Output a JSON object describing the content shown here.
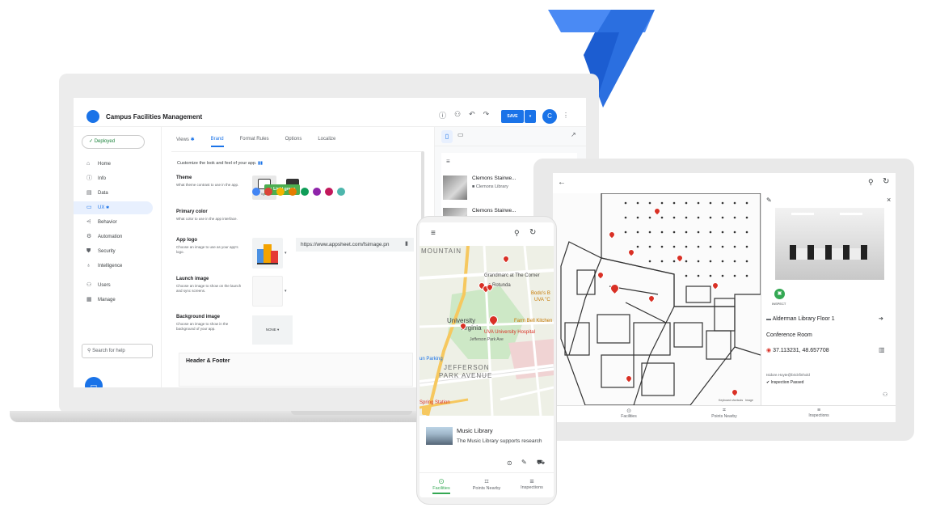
{
  "colors": {
    "brand_blue": "#1a73e8",
    "brand_dark": "#1967d2",
    "deployed_green": "#188038",
    "pin_red": "#d93025",
    "nav_active_green": "#34a853"
  },
  "laptop": {
    "app_title": "Campus Facilities Management",
    "toolbar": {
      "save_label": "SAVE",
      "avatar_initial": "C",
      "icons": [
        "help-icon",
        "add-user-icon",
        "undo-icon",
        "redo-icon"
      ]
    },
    "sidebar": {
      "deployed_label": "Deployed",
      "items": [
        {
          "label": "Home",
          "icon": "home-icon"
        },
        {
          "label": "Info",
          "icon": "info-icon"
        },
        {
          "label": "Data",
          "icon": "data-icon"
        },
        {
          "label": "UX",
          "icon": "ux-icon",
          "active": true
        },
        {
          "label": "Behavior",
          "icon": "behavior-icon"
        },
        {
          "label": "Automation",
          "icon": "automation-icon"
        },
        {
          "label": "Security",
          "icon": "security-icon"
        },
        {
          "label": "Intelligence",
          "icon": "intelligence-icon"
        },
        {
          "label": "Users",
          "icon": "users-icon"
        },
        {
          "label": "Manage",
          "icon": "manage-icon"
        }
      ],
      "search_placeholder": "Search for help"
    },
    "tabs": [
      {
        "label": "Views"
      },
      {
        "label": "Brand",
        "active": true
      },
      {
        "label": "Format Rules"
      },
      {
        "label": "Options"
      },
      {
        "label": "Localize"
      }
    ],
    "brand": {
      "intro": "Customize the look and feel of your app.",
      "theme": {
        "label": "Theme",
        "desc": "What theme contrast to use in the app.",
        "options": [
          "light",
          "dark"
        ]
      },
      "primary_color": {
        "label": "Primary color",
        "desc": "What color to use in the app interface.",
        "swatches": [
          "#4285f4",
          "#db4437",
          "#f4b400",
          "#e67c00",
          "#0f9d58",
          "#8e24aa",
          "#c2185b",
          "#4db6ac"
        ],
        "selected": "Light green"
      },
      "app_logo": {
        "label": "App logo",
        "desc": "Choose an image to use as your app's logo.",
        "url": "https://www.appsheet.com/fsimage.pn"
      },
      "launch_image": {
        "label": "Launch image",
        "desc": "Choose an image to show on the launch and sync screens."
      },
      "background_image": {
        "label": "Background image",
        "desc": "Choose an image to show in the background of your app.",
        "value": "NONE"
      },
      "header_footer": "Header & Footer"
    },
    "preview_list": [
      {
        "title": "Clemons Stairwe...",
        "sub": "Clemons Library"
      },
      {
        "title": "Clemons Stairwe...",
        "sub": ""
      }
    ]
  },
  "tablet": {
    "detail": {
      "badge": "INSPECT",
      "title": "Alderman Library Floor 1",
      "room": "Conference Room",
      "coords": "37.113231, 48.657708",
      "inspector": "Isidore.Hoyte@brickfinhold",
      "status": "Inspection Passed"
    },
    "map_footer": "Keyboard shortcuts",
    "map_footer_2": "Image",
    "nav": [
      "Facilities",
      "Points Nearby",
      "Inspections"
    ]
  },
  "phone": {
    "map_labels": {
      "mountain": "MOUNTAIN",
      "grandmarc": "Grandmarc at The Corner",
      "rotunda": "e Rotunda",
      "bodo": "Bodo's B",
      "uva_c": "UVA \"C",
      "farm_bell": "Farm Bell Kitchen",
      "university": "University",
      "virginia": "Virginia",
      "uva_hospital": "UVA University Hospital",
      "jefferson_park": "Jefferson Park Ave",
      "sun_parking": "un Parking",
      "jefferson": "JEFFERSON",
      "park_avenue": "PARK AVENUE",
      "spring_station": "Spring Station"
    },
    "card": {
      "title": "Music Library",
      "subtitle": "The Music Library supports research"
    },
    "nav": [
      "Facilities",
      "Points Nearby",
      "Inspections"
    ]
  }
}
